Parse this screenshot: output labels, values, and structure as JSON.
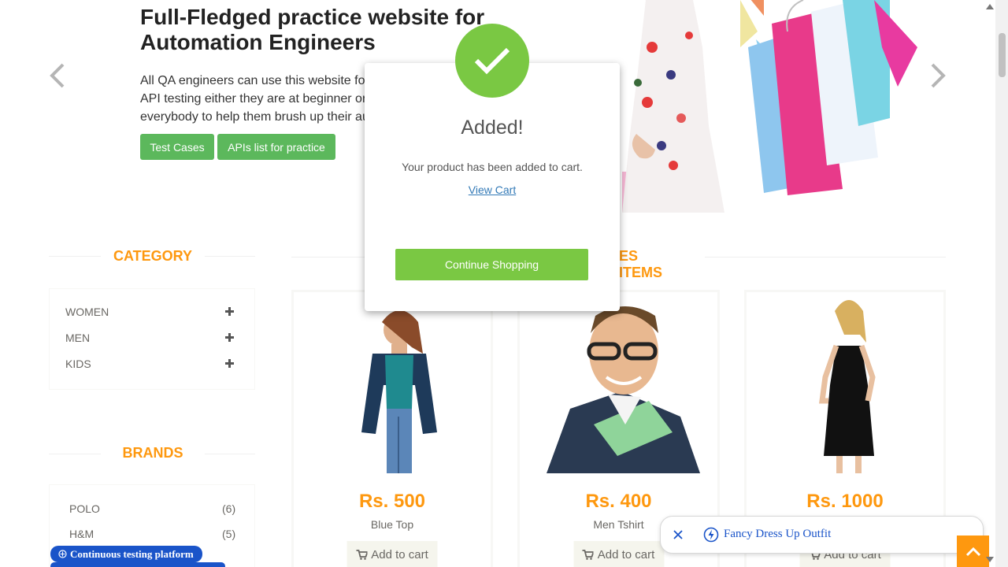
{
  "hero": {
    "title": "Full-Fledged practice website for Automation Engineers",
    "desc_line1": "All QA engineers can use this website fo",
    "desc_line2": "API testing either they are at beginner or",
    "desc_line3": "everybody to help them brush up their au",
    "btn_test_cases": "Test Cases",
    "btn_apis": "APIs list for practice"
  },
  "category": {
    "title": "CATEGORY",
    "items": [
      {
        "label": "WOMEN"
      },
      {
        "label": "MEN"
      },
      {
        "label": "KIDS"
      }
    ]
  },
  "brands": {
    "title": "BRANDS",
    "items": [
      {
        "label": "POLO",
        "count": "(6)"
      },
      {
        "label": "H&M",
        "count": "(5)"
      }
    ]
  },
  "features": {
    "title_visible": "ES ITEMS"
  },
  "products": [
    {
      "price": "Rs. 500",
      "name": "Blue Top",
      "button": "Add to cart"
    },
    {
      "price": "Rs. 400",
      "name": "Men Tshirt",
      "button": "Add to cart"
    },
    {
      "price": "Rs. 1000",
      "name": "",
      "button": "Add to cart"
    }
  ],
  "modal": {
    "title": "Added!",
    "body": "Your product has been added to cart.",
    "link": "View Cart",
    "button": "Continue Shopping"
  },
  "ad": {
    "label": "Continuous testing platform"
  },
  "suggestion": {
    "text": "Fancy Dress Up Outfit"
  },
  "colors": {
    "accent": "#fe980f",
    "green": "#5cb85c",
    "modal_green": "#7ac843",
    "link_blue": "#337ab7"
  }
}
